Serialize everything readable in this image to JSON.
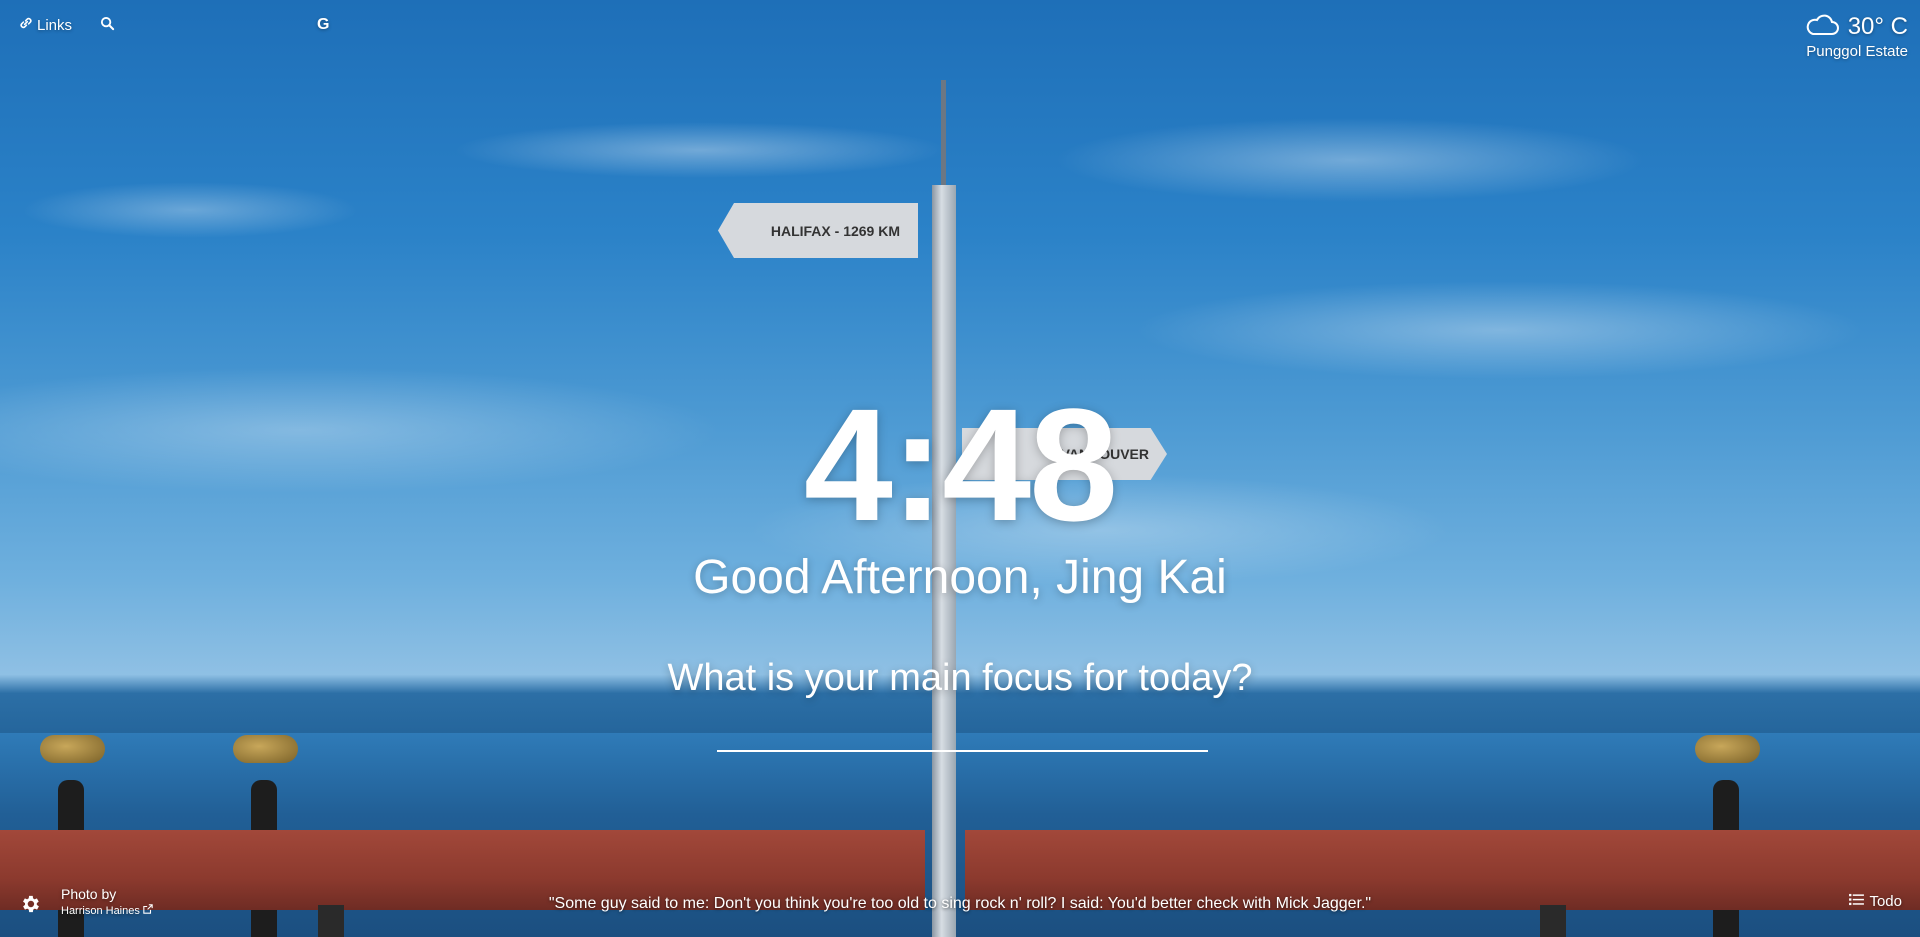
{
  "topbar": {
    "links_label": "Links",
    "search_icon": "search-icon",
    "google_label": "G"
  },
  "weather": {
    "temperature": "30° C",
    "location": "Punggol Estate",
    "icon": "cloud-icon"
  },
  "clock": {
    "time": "4:48"
  },
  "greeting": {
    "text": "Good Afternoon, Jing Kai"
  },
  "focus": {
    "question": "What is your main focus for today?",
    "input_value": ""
  },
  "photo_credit": {
    "title": "Photo by",
    "author": "Harrison Haines"
  },
  "quote": {
    "text": "\"Some guy said to me: Don't you think you're too old to sing rock n' roll? I said: You'd better check with Mick Jagger.\""
  },
  "todo": {
    "label": "Todo"
  },
  "scene": {
    "sign_halifax": "HALIFAX - 1269 KM",
    "sign_vancouver": "VANCOUVER"
  }
}
